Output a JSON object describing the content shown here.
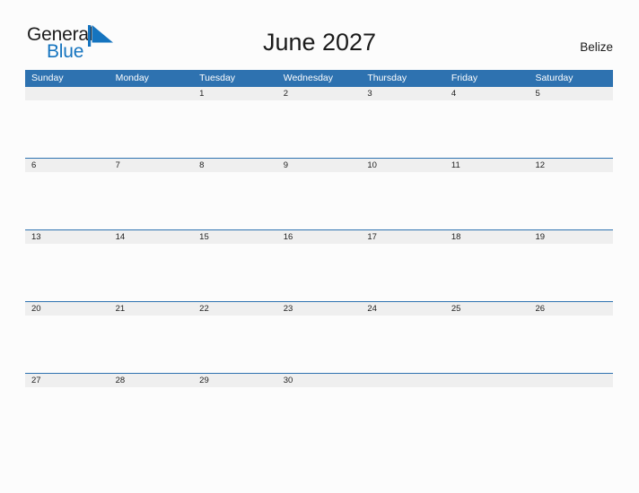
{
  "brand": {
    "name_top": "General",
    "name_bottom": "Blue",
    "top_color": "#1b1b1b",
    "bottom_color": "#1574bf",
    "sail_icon": "sail-triangle-icon",
    "sail_color": "#1574bf"
  },
  "header": {
    "title": "June 2027",
    "locale": "Belize"
  },
  "theme": {
    "header_blue": "#2e72b0",
    "row_band_gray": "#efefef",
    "page_background": "#fcfcfc",
    "rule_blue": "#2e72b0"
  },
  "calendar": {
    "weekday_headers": [
      "Sunday",
      "Monday",
      "Tuesday",
      "Wednesday",
      "Thursday",
      "Friday",
      "Saturday"
    ],
    "weeks": [
      [
        "",
        "",
        "1",
        "2",
        "3",
        "4",
        "5"
      ],
      [
        "6",
        "7",
        "8",
        "9",
        "10",
        "11",
        "12"
      ],
      [
        "13",
        "14",
        "15",
        "16",
        "17",
        "18",
        "19"
      ],
      [
        "20",
        "21",
        "22",
        "23",
        "24",
        "25",
        "26"
      ],
      [
        "27",
        "28",
        "29",
        "30",
        "",
        "",
        ""
      ]
    ]
  }
}
